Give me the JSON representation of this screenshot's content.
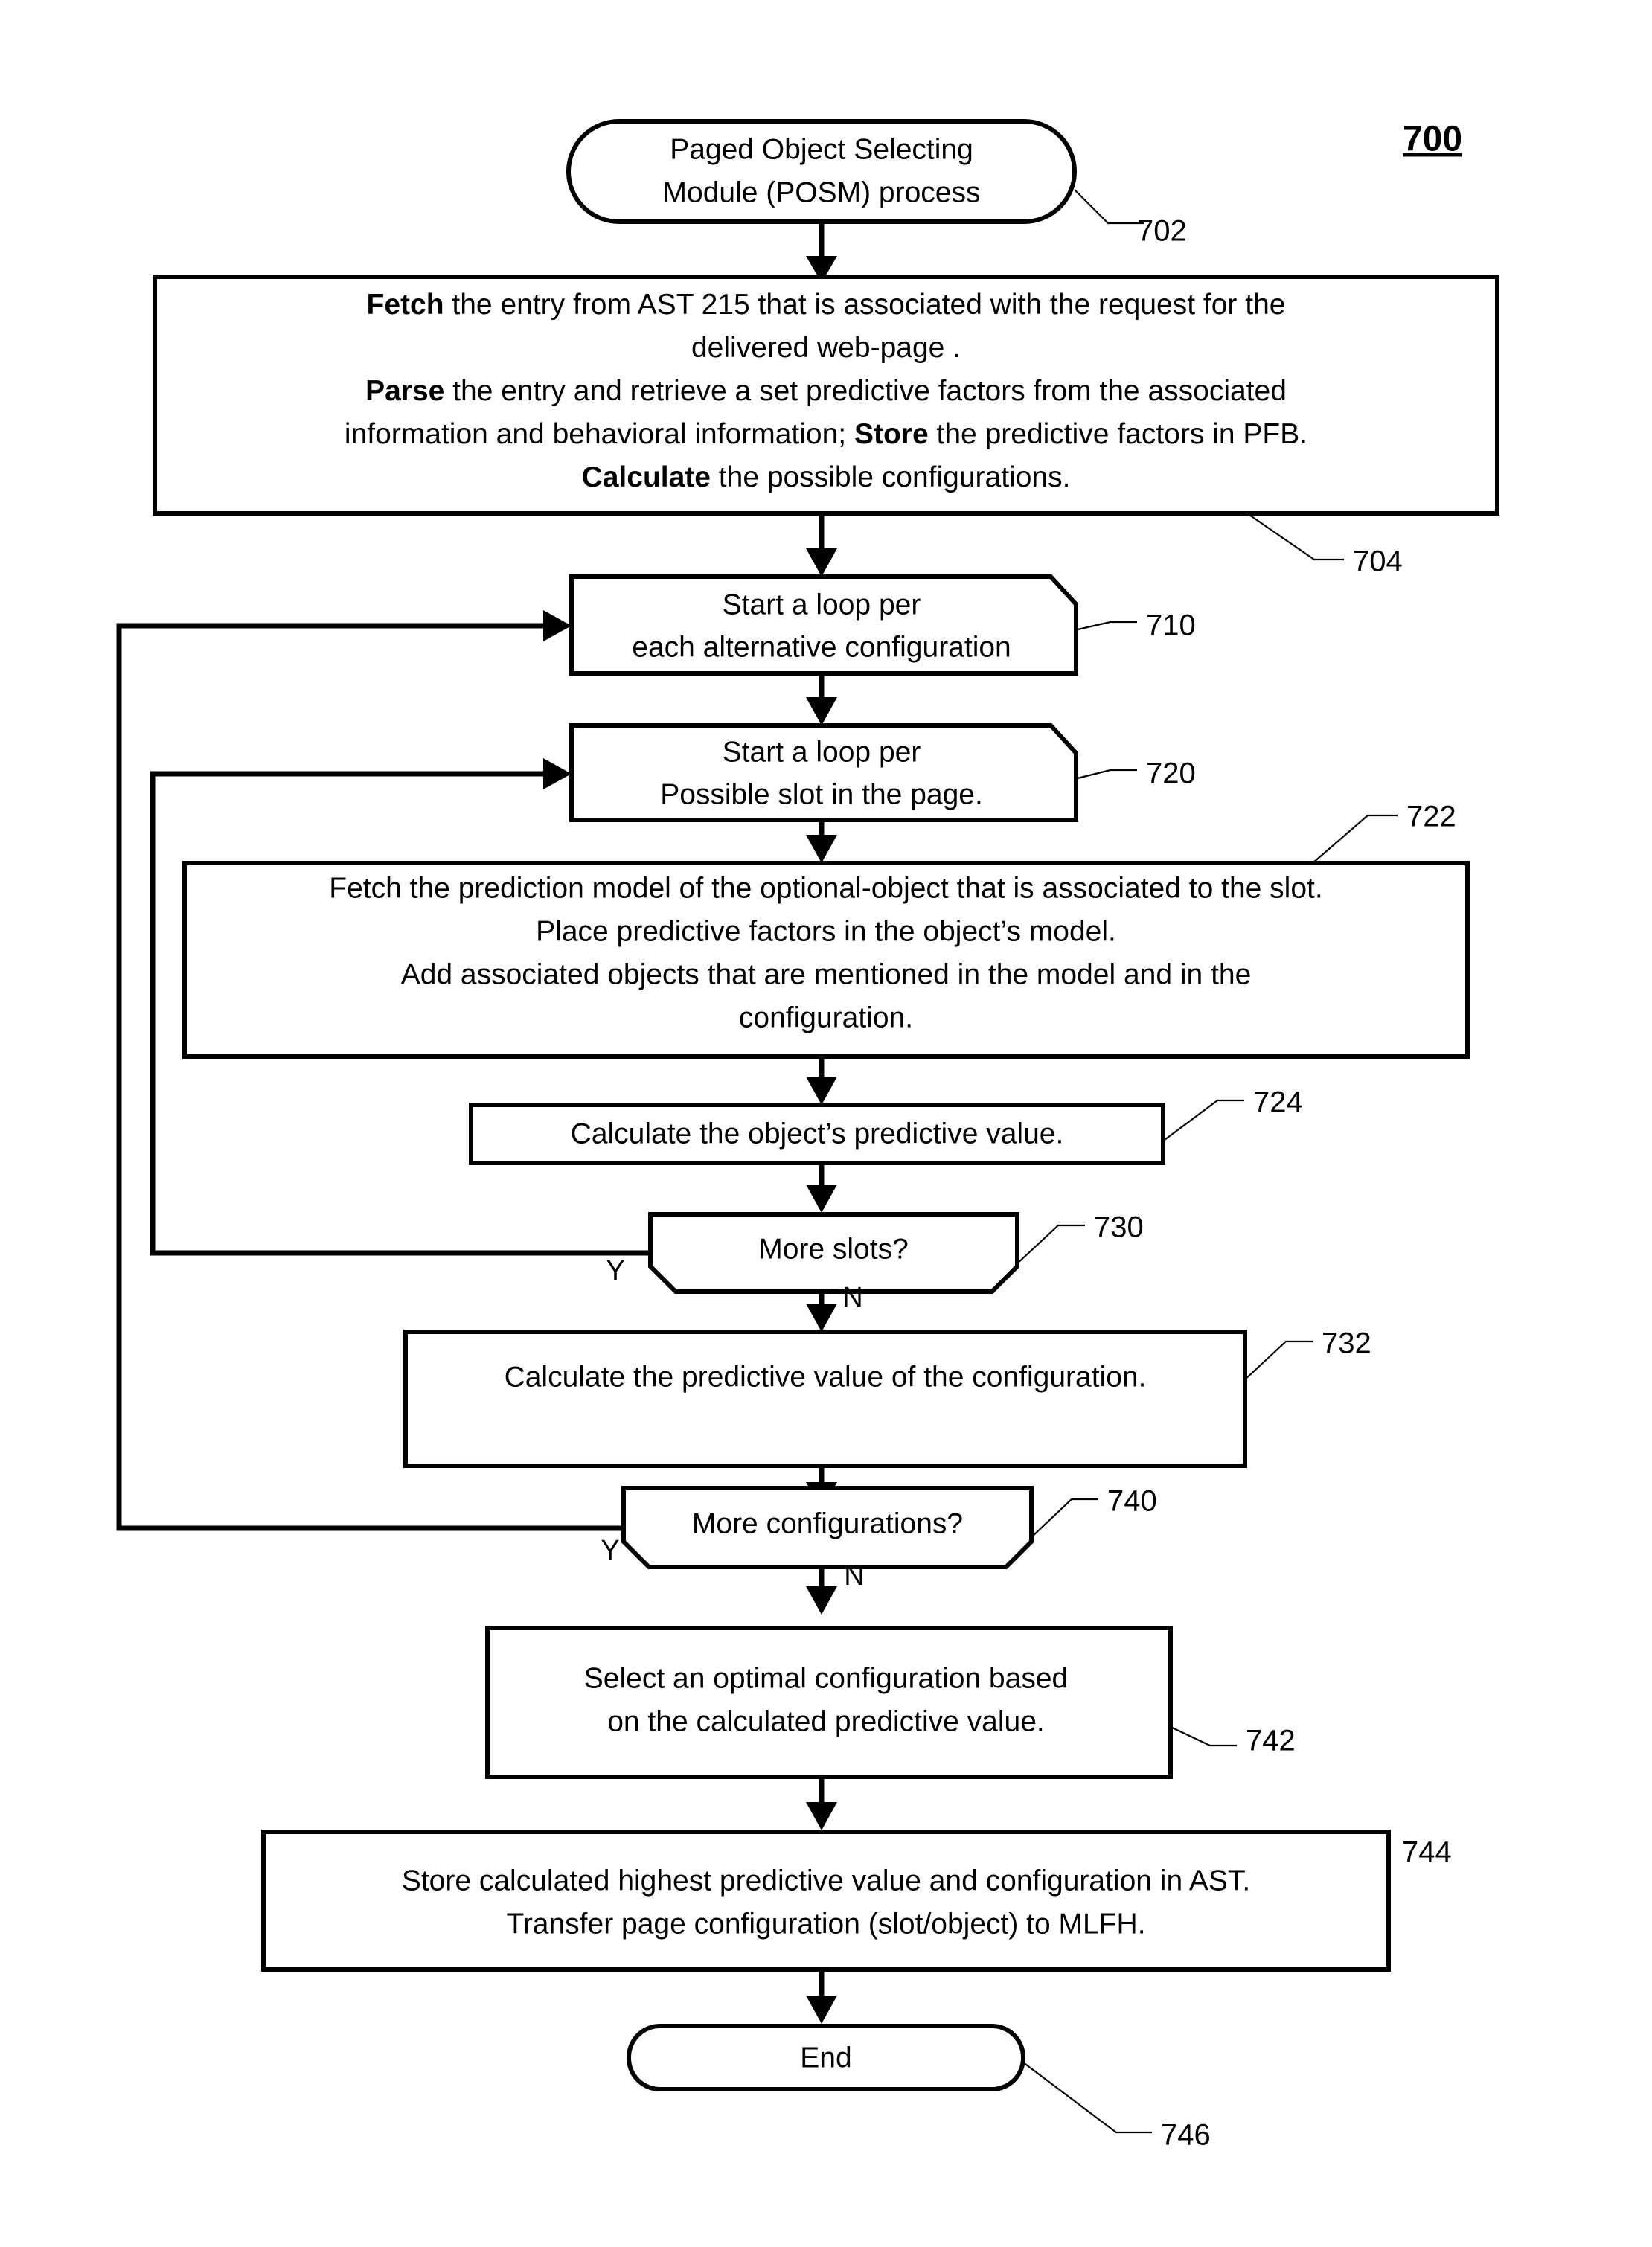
{
  "figure": {
    "number": "700"
  },
  "nodes": {
    "start": {
      "ref": "702",
      "lines": [
        "Paged Object Selecting",
        "Module (POSM) process"
      ]
    },
    "fetch_parse": {
      "ref": "704",
      "lines": [
        [
          {
            "t": "Fetch",
            "b": true
          },
          {
            "t": " the entry from AST 215 that is associated with the request for the",
            "b": false
          }
        ],
        [
          {
            "t": "delivered web-page .",
            "b": false
          }
        ],
        [
          {
            "t": "Parse",
            "b": true
          },
          {
            "t": " the entry and retrieve a set predictive factors from the associated",
            "b": false
          }
        ],
        [
          {
            "t": "information and behavioral information; ",
            "b": false
          },
          {
            "t": "Store",
            "b": true
          },
          {
            "t": "  the predictive factors in PFB.",
            "b": false
          }
        ],
        [
          {
            "t": "Calculate",
            "b": true
          },
          {
            "t": " the possible configurations.",
            "b": false
          }
        ]
      ]
    },
    "loop_config_start": {
      "ref": "710",
      "lines": [
        "Start a loop per",
        "each alternative configuration"
      ]
    },
    "loop_slot_start": {
      "ref": "720",
      "lines": [
        "Start a loop per",
        "Possible slot in the page."
      ]
    },
    "fetch_model": {
      "ref": "722",
      "lines": [
        "Fetch the prediction model of the optional-object that is associated to the slot.",
        "Place predictive factors in the object’s model.",
        "Add associated objects that are mentioned in the model and in the",
        "configuration."
      ]
    },
    "calc_object_value": {
      "ref": "724",
      "lines": [
        "Calculate the object’s predictive value."
      ]
    },
    "more_slots": {
      "ref": "730",
      "lines": [
        "More slots?"
      ],
      "yes_label": "Y",
      "no_label": "N"
    },
    "calc_config_value": {
      "ref": "732",
      "lines": [
        "Calculate the predictive value of the configuration."
      ]
    },
    "more_configs": {
      "ref": "740",
      "lines": [
        "More configurations?"
      ],
      "yes_label": "Y",
      "no_label": "N"
    },
    "select_optimal": {
      "ref": "742",
      "lines": [
        "Select an optimal configuration based",
        "on the calculated predictive value."
      ]
    },
    "store_transfer": {
      "ref": "744",
      "lines": [
        "Store calculated highest predictive value and configuration in AST.",
        "Transfer page configuration (slot/object) to MLFH."
      ]
    },
    "end": {
      "ref": "746",
      "lines": [
        "End"
      ]
    }
  },
  "colors": {
    "stroke": "#000000",
    "fill": "#ffffff",
    "text": "#000000"
  }
}
